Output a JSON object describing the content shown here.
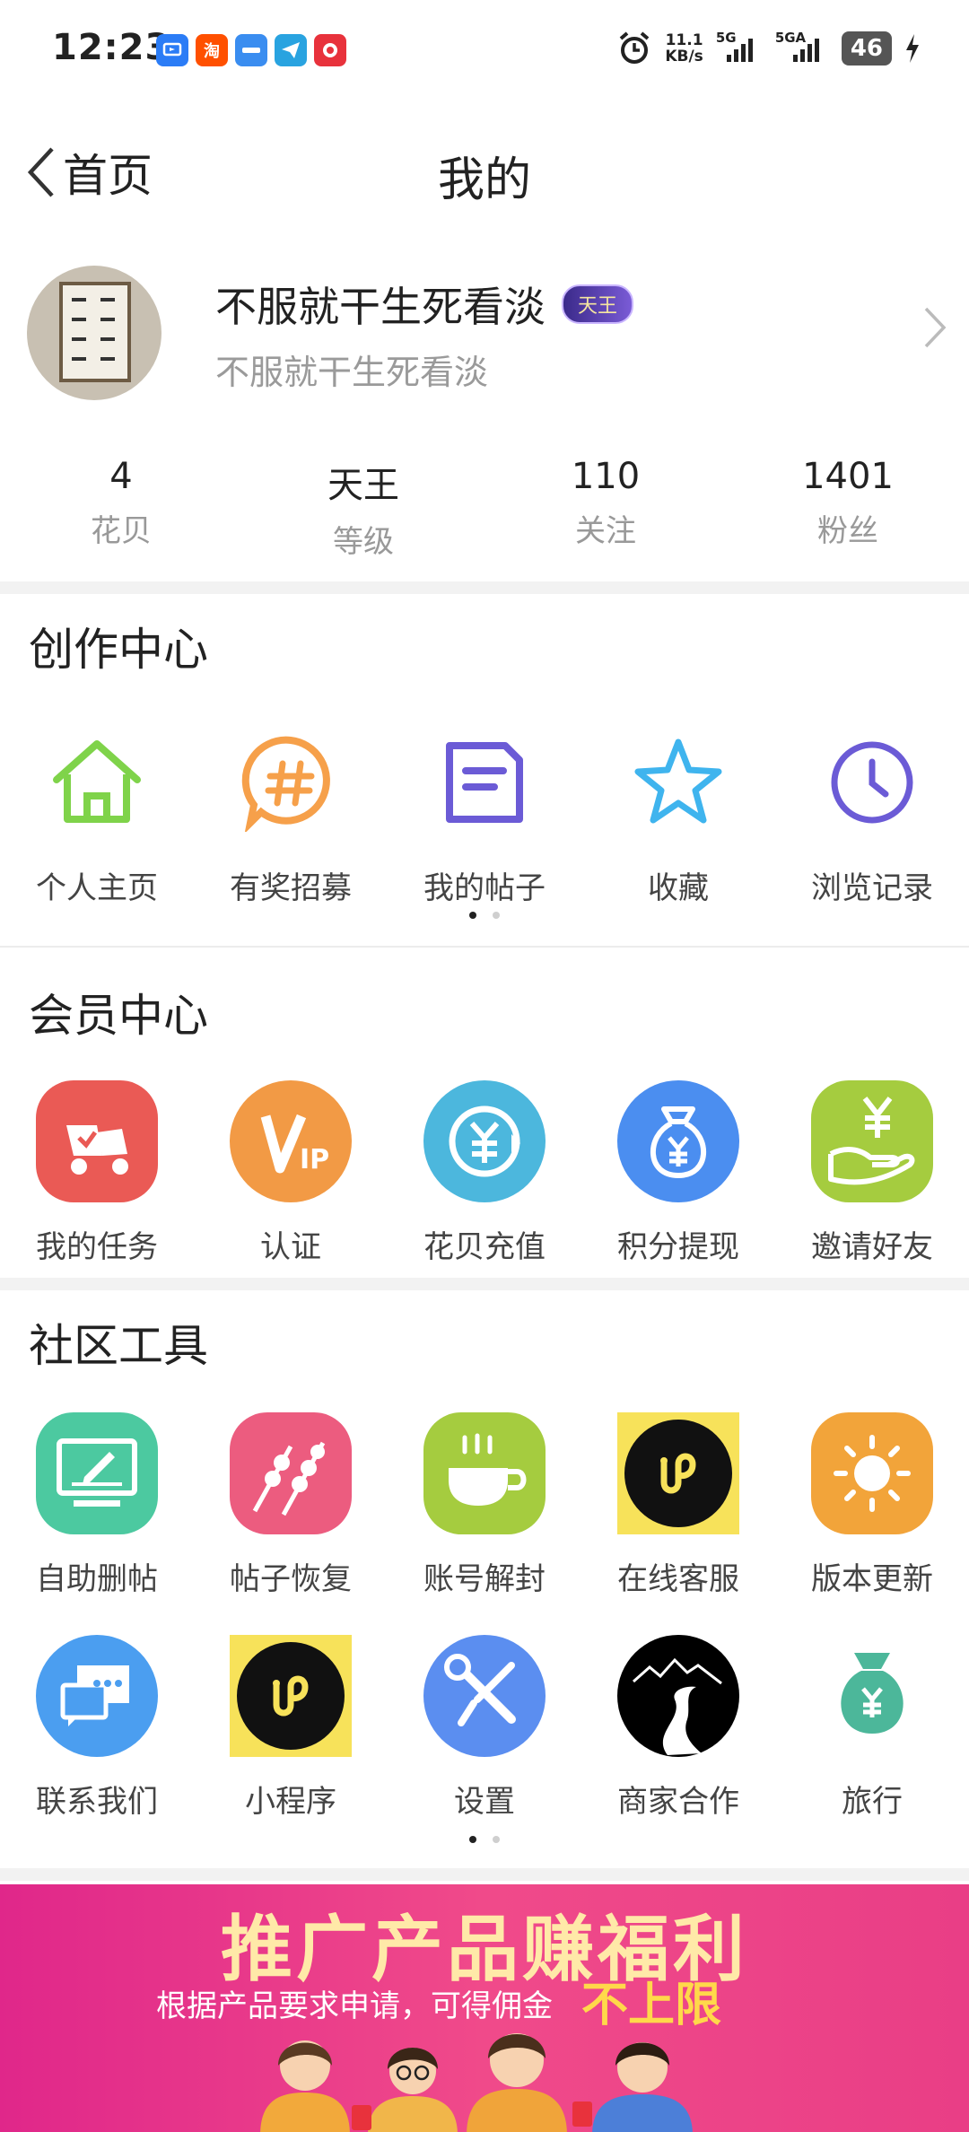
{
  "status_bar": {
    "time": "12:23",
    "apps": [
      {
        "icon": "tv-app-icon",
        "label": "",
        "color": "#2b7cf6"
      },
      {
        "icon": "taobao-app-icon",
        "label": "淘",
        "color": "#ff5000"
      },
      {
        "icon": "news-app-icon",
        "label": "",
        "color": "#3a8df0"
      },
      {
        "icon": "telegram-app-icon",
        "label": "",
        "color": "#29a3e0"
      },
      {
        "icon": "red-app-icon",
        "label": "",
        "color": "#e8323c"
      }
    ],
    "net_speed": "11.1",
    "net_unit": "KB/s",
    "sig1": "5G",
    "sig2": "5GA",
    "battery": "46"
  },
  "nav": {
    "back_label": "首页",
    "title": "我的"
  },
  "profile": {
    "name": "不服就干生死看淡",
    "badge": "天王",
    "subtitle": "不服就干生死看淡"
  },
  "stats": [
    {
      "value": "4",
      "label": "花贝"
    },
    {
      "value": "天王",
      "label": "等级"
    },
    {
      "value": "110",
      "label": "关注"
    },
    {
      "value": "1401",
      "label": "粉丝"
    }
  ],
  "creation": {
    "title": "创作中心",
    "items": [
      {
        "label": "个人主页",
        "icon": "home-icon"
      },
      {
        "label": "有奖招募",
        "icon": "hashtag-bubble-icon"
      },
      {
        "label": "我的帖子",
        "icon": "document-icon"
      },
      {
        "label": "收藏",
        "icon": "star-icon"
      },
      {
        "label": "浏览记录",
        "icon": "clock-icon"
      }
    ]
  },
  "member": {
    "title": "会员中心",
    "items": [
      {
        "label": "我的任务",
        "icon": "task-icon",
        "color": "#ea5a55"
      },
      {
        "label": "认证",
        "icon": "vip-icon",
        "color": "#f29a45"
      },
      {
        "label": "花贝充值",
        "icon": "yuan-recharge-icon",
        "color": "#4cb7dd"
      },
      {
        "label": "积分提现",
        "icon": "money-bag-icon",
        "color": "#4b8ef0"
      },
      {
        "label": "邀请好友",
        "icon": "hand-yuan-icon",
        "color": "#a5cc3f"
      }
    ]
  },
  "tools": {
    "title": "社区工具",
    "row1": [
      {
        "label": "自助删帖",
        "icon": "monitor-edit-icon",
        "color": "#4cc9a0"
      },
      {
        "label": "帖子恢复",
        "icon": "skewer-icon",
        "color": "#ec5c7f"
      },
      {
        "label": "账号解封",
        "icon": "coffee-cup-icon",
        "color": "#a5cc3f"
      },
      {
        "label": "在线客服",
        "icon": "mini-program-icon",
        "color": "#f7e25a"
      },
      {
        "label": "版本更新",
        "icon": "sun-icon",
        "color": "#f2a43a"
      }
    ],
    "row2": [
      {
        "label": "联系我们",
        "icon": "chat-bubbles-icon",
        "color": "#4b9ef0"
      },
      {
        "label": "小程序",
        "icon": "mini-program-icon",
        "color": "#f7e25a"
      },
      {
        "label": "设置",
        "icon": "wrench-screwdriver-icon",
        "color": "#5b8ef0"
      },
      {
        "label": "商家合作",
        "icon": "road-mountain-icon",
        "color": "#000000"
      },
      {
        "label": "旅行",
        "icon": "money-bag-icon",
        "color": "#4cb79a"
      }
    ]
  },
  "banner": {
    "title": "推广产品赚福利",
    "subtitle": "根据产品要求申请，可得佣金",
    "highlight": "不上限"
  }
}
